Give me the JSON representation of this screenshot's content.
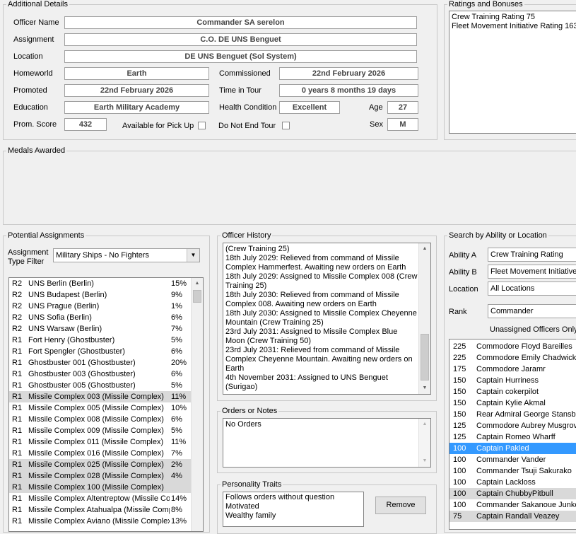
{
  "details": {
    "legend": "Additional Details",
    "officer_name_label": "Officer Name",
    "officer_name": "Commander SA serelon",
    "assignment_label": "Assignment",
    "assignment": "C.O. DE UNS Benguet",
    "location_label": "Location",
    "location": "DE UNS Benguet (Sol System)",
    "homeworld_label": "Homeworld",
    "homeworld": "Earth",
    "commissioned_label": "Commissioned",
    "commissioned": "22nd February 2026",
    "promoted_label": "Promoted",
    "promoted": "22nd February 2026",
    "time_in_tour_label": "Time in Tour",
    "time_in_tour": "0 years 8 months 19 days",
    "education_label": "Education",
    "education": "Earth Military Academy",
    "health_label": "Health Condition",
    "health": "Excellent",
    "age_label": "Age",
    "age": "27",
    "prom_score_label": "Prom. Score",
    "prom_score": "432",
    "pickup_label": "Available for Pick Up",
    "no_end_tour_label": "Do Not End Tour",
    "sex_label": "Sex",
    "sex": "M"
  },
  "ratings": {
    "legend": "Ratings and Bonuses",
    "items": [
      "Crew Training Rating 75",
      "Fleet Movement Initiative Rating 163"
    ]
  },
  "medals": {
    "legend": "Medals Awarded"
  },
  "potential": {
    "legend": "Potential Assignments",
    "filter_label_1": "Assignment",
    "filter_label_2": "Type Filter",
    "filter_value": "Military Ships - No Fighters",
    "rows": [
      {
        "rank": "R2",
        "name": "UNS Berlin (Berlin)",
        "pct": "15%",
        "sel": false
      },
      {
        "rank": "R2",
        "name": "UNS Budapest (Berlin)",
        "pct": "9%",
        "sel": false
      },
      {
        "rank": "R2",
        "name": "UNS Prague (Berlin)",
        "pct": "1%",
        "sel": false
      },
      {
        "rank": "R2",
        "name": "UNS Sofia (Berlin)",
        "pct": "6%",
        "sel": false
      },
      {
        "rank": "R2",
        "name": "UNS Warsaw (Berlin)",
        "pct": "7%",
        "sel": false
      },
      {
        "rank": "R1",
        "name": "Fort Henry (Ghostbuster)",
        "pct": "5%",
        "sel": false
      },
      {
        "rank": "R1",
        "name": "Fort Spengler (Ghostbuster)",
        "pct": "6%",
        "sel": false
      },
      {
        "rank": "R1",
        "name": "Ghostbuster 001 (Ghostbuster)",
        "pct": "20%",
        "sel": false
      },
      {
        "rank": "R1",
        "name": "Ghostbuster 003 (Ghostbuster)",
        "pct": "6%",
        "sel": false
      },
      {
        "rank": "R1",
        "name": "Ghostbuster 005 (Ghostbuster)",
        "pct": "5%",
        "sel": false
      },
      {
        "rank": "R1",
        "name": "Missile Complex 003 (Missile Complex)",
        "pct": "11%",
        "sel": true
      },
      {
        "rank": "R1",
        "name": "Missile Complex 005 (Missile Complex)",
        "pct": "10%",
        "sel": false
      },
      {
        "rank": "R1",
        "name": "Missile Complex 008 (Missile Complex)",
        "pct": "6%",
        "sel": false
      },
      {
        "rank": "R1",
        "name": "Missile Complex 009 (Missile Complex)",
        "pct": "5%",
        "sel": false
      },
      {
        "rank": "R1",
        "name": "Missile Complex 011 (Missile Complex)",
        "pct": "11%",
        "sel": false
      },
      {
        "rank": "R1",
        "name": "Missile Complex 016 (Missile Complex)",
        "pct": "7%",
        "sel": false
      },
      {
        "rank": "R1",
        "name": "Missile Complex 025 (Missile Complex)",
        "pct": "2%",
        "sel": true
      },
      {
        "rank": "R1",
        "name": "Missile Complex 028 (Missile Complex)",
        "pct": "4%",
        "sel": true
      },
      {
        "rank": "R1",
        "name": "Missile Complex 100 (Missile Complex)",
        "pct": "",
        "sel": true
      },
      {
        "rank": "R1",
        "name": "Missile Complex Altentreptow (Missile Com",
        "pct": "14%",
        "sel": false
      },
      {
        "rank": "R1",
        "name": "Missile Complex Atahualpa (Missile Comple",
        "pct": "8%",
        "sel": false
      },
      {
        "rank": "R1",
        "name": "Missile Complex Aviano (Missile Complex)",
        "pct": "13%",
        "sel": false
      }
    ]
  },
  "history": {
    "legend": "Officer History",
    "lines": [
      "(Crew Training 25)",
      "18th July 2029: Relieved from command of Missile Complex Hammerfest. Awaiting new orders on Earth",
      "18th July 2029: Assigned to Missile Complex 008 (Crew Training 25)",
      "18th July 2030: Relieved from command of Missile Complex 008. Awaiting new orders on Earth",
      "18th July 2030: Assigned to Missile Complex Cheyenne Mountain (Crew Training 25)",
      "23rd July 2031: Assigned to Missile Complex Blue Moon (Crew Training 50)",
      "23rd July 2031: Relieved from command of Missile Complex Cheyenne Mountain. Awaiting new orders on Earth",
      "4th November 2031: Assigned to UNS Benguet (Surigao)"
    ]
  },
  "orders": {
    "legend": "Orders or Notes",
    "text": "No Orders"
  },
  "traits": {
    "legend": "Personality Traits",
    "items": [
      "Follows orders without question",
      "Motivated",
      "Wealthy family"
    ],
    "remove_label": "Remove"
  },
  "search": {
    "legend": "Search by Ability or Location",
    "ability_a_label": "Ability A",
    "ability_a": "Crew Training Rating",
    "ability_b_label": "Ability B",
    "ability_b": "Fleet Movement Initiative",
    "location_label": "Location",
    "location": "All Locations",
    "rank_label": "Rank",
    "rank": "Commander",
    "unassigned_label": "Unassigned Officers Only",
    "rows": [
      {
        "score": "225",
        "name": "Commodore Floyd Bareilles",
        "state": ""
      },
      {
        "score": "225",
        "name": "Commodore Emily Chadwick",
        "state": ""
      },
      {
        "score": "175",
        "name": "Commodore Jaramr",
        "state": ""
      },
      {
        "score": "150",
        "name": "Captain Hurriness",
        "state": ""
      },
      {
        "score": "150",
        "name": "Captain cokerpilot",
        "state": ""
      },
      {
        "score": "150",
        "name": "Captain Kylie Akmal",
        "state": ""
      },
      {
        "score": "150",
        "name": "Rear Admiral George Stansbe",
        "state": ""
      },
      {
        "score": "125",
        "name": "Commodore Aubrey Musgrove",
        "state": ""
      },
      {
        "score": "125",
        "name": "Captain Romeo Wharff",
        "state": ""
      },
      {
        "score": "100",
        "name": "Captain Pakled",
        "state": "hl"
      },
      {
        "score": "100",
        "name": "Commander Vander",
        "state": ""
      },
      {
        "score": "100",
        "name": "Commander Tsuji Sakurako",
        "state": ""
      },
      {
        "score": "100",
        "name": "Captain Lackloss",
        "state": ""
      },
      {
        "score": "100",
        "name": "Captain ChubbyPitbull",
        "state": "sel"
      },
      {
        "score": "100",
        "name": "Commander Sakanoue Junko",
        "state": ""
      },
      {
        "score": "75",
        "name": "Captain Randall Veazey",
        "state": "sel"
      }
    ]
  }
}
